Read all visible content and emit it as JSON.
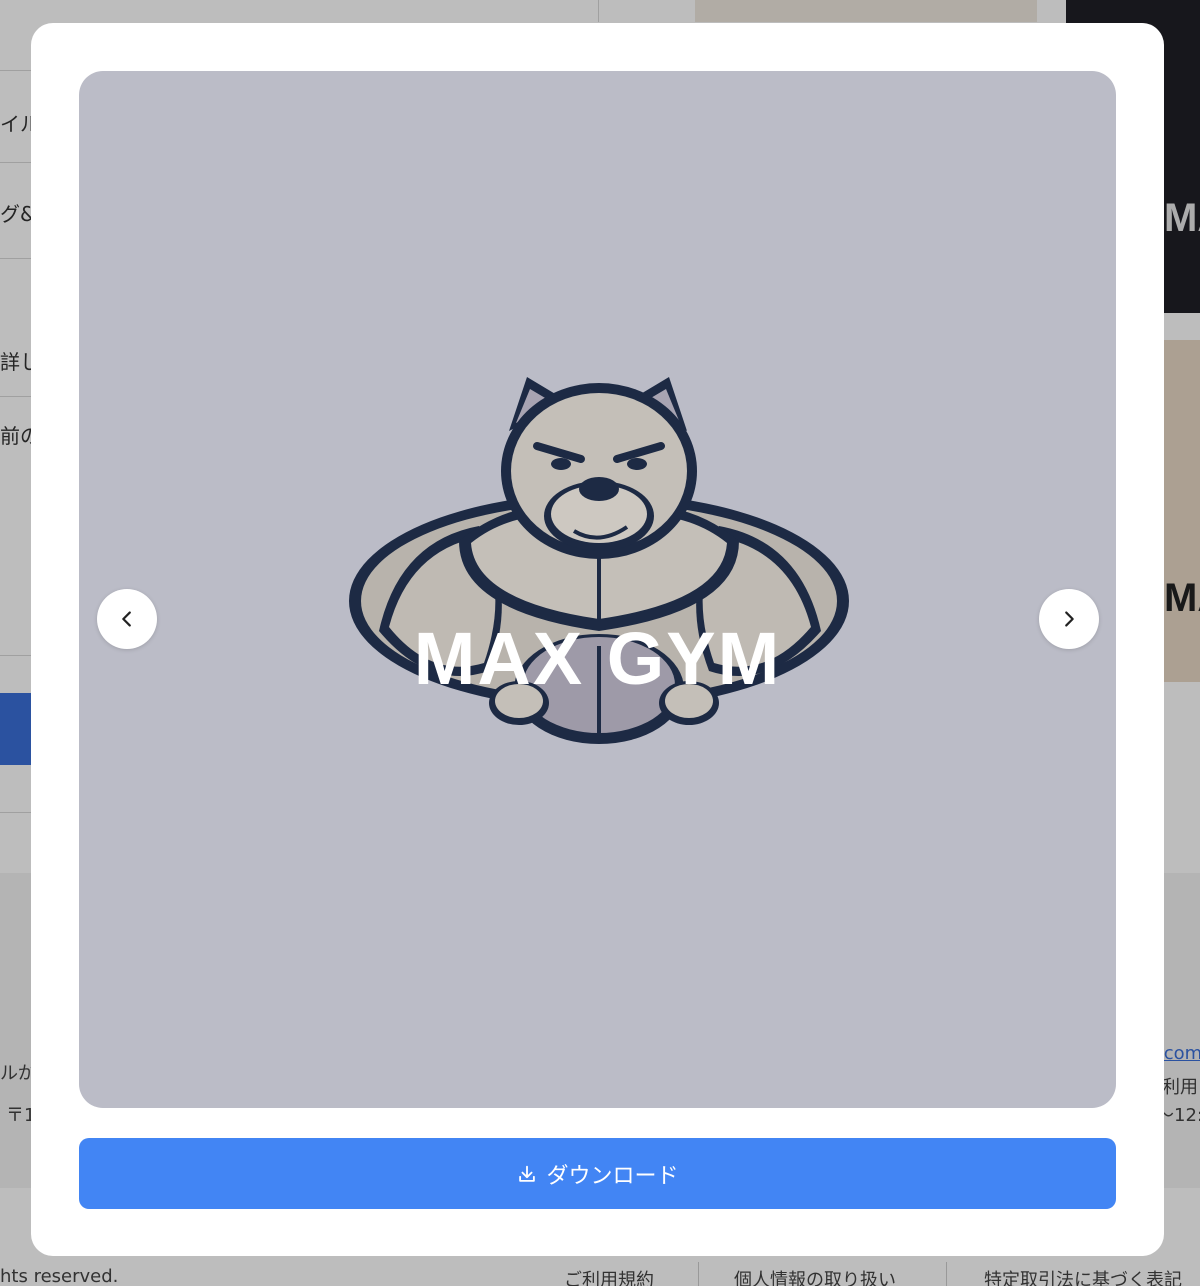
{
  "background": {
    "left_items": [
      "イル",
      "グ&",
      "詳し",
      "前の"
    ],
    "right_thumb_text_1": "MA",
    "right_thumb_text_2": "MA",
    "gray_left_1": "ルが",
    "gray_left_2": "〒1",
    "gray_right_1": ".com",
    "gray_right_2": "利用",
    "gray_right_3": "～12:",
    "footer_copyright": "hts reserved.",
    "footer_links": [
      "ご利用規約",
      "個人情報の取り扱い",
      "特定取引法に基づく表記"
    ]
  },
  "modal": {
    "image": {
      "logo_text": "MAX GYM",
      "mascot_icon": "bulldog-mascot-icon"
    },
    "prev_icon": "chevron-left-icon",
    "next_icon": "chevron-right-icon",
    "download": {
      "icon": "download-icon",
      "label": "ダウンロード"
    }
  },
  "colors": {
    "download_button": "#4285f4",
    "image_background": "#bbbcc7",
    "overlay": "rgba(0,0,0,0.26)"
  }
}
